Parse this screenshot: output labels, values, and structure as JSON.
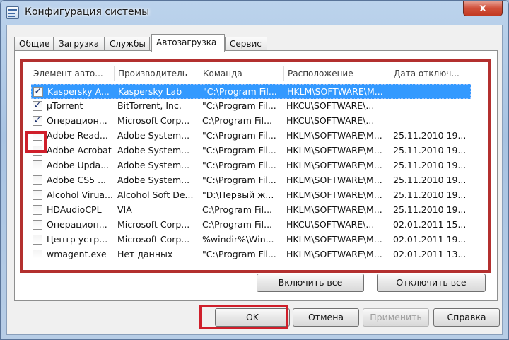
{
  "window": {
    "title": "Конфигурация системы",
    "close_glyph": "x"
  },
  "tabs": [
    {
      "label": "Общие",
      "active": false
    },
    {
      "label": "Загрузка",
      "active": false
    },
    {
      "label": "Службы",
      "active": false
    },
    {
      "label": "Автозагрузка",
      "active": true
    },
    {
      "label": "Сервис",
      "active": false
    }
  ],
  "table": {
    "columns": [
      "Элемент авто...",
      "Производитель",
      "Команда",
      "Расположение",
      "Дата отключ..."
    ],
    "rows": [
      {
        "checked": true,
        "selected": true,
        "name": "Kaspersky A...",
        "vendor": "Kaspersky Lab",
        "command": "\"C:\\Program Fil...",
        "location": "HKLM\\SOFTWARE\\M...",
        "date": ""
      },
      {
        "checked": true,
        "selected": false,
        "name": "µTorrent",
        "vendor": "BitTorrent, Inc.",
        "command": "\"C:\\Program Fil...",
        "location": "HKCU\\SOFTWARE\\...",
        "date": ""
      },
      {
        "checked": true,
        "selected": false,
        "name": "Операцион...",
        "vendor": "Microsoft Corp...",
        "command": "C:\\Program Fil...",
        "location": "HKCU\\SOFTWARE\\...",
        "date": ""
      },
      {
        "checked": false,
        "selected": false,
        "name": "Adobe Read...",
        "vendor": "Adobe System...",
        "command": "\"C:\\Program Fil...",
        "location": "HKLM\\SOFTWARE\\M...",
        "date": "25.11.2010 19..."
      },
      {
        "checked": false,
        "selected": false,
        "name": "Adobe Acrobat",
        "vendor": "Adobe System...",
        "command": "\"C:\\Program Fil...",
        "location": "HKLM\\SOFTWARE\\M...",
        "date": "25.11.2010 19..."
      },
      {
        "checked": false,
        "selected": false,
        "name": "Adobe Upda...",
        "vendor": "Adobe System...",
        "command": "\"C:\\Program Fil...",
        "location": "HKLM\\SOFTWARE\\M...",
        "date": "25.11.2010 19..."
      },
      {
        "checked": false,
        "selected": false,
        "name": "Adobe CS5 ...",
        "vendor": "Adobe System...",
        "command": "\"C:\\Program Fil...",
        "location": "HKLM\\SOFTWARE\\M...",
        "date": "25.11.2010 19..."
      },
      {
        "checked": false,
        "selected": false,
        "name": "Alcohol Virua...",
        "vendor": "Alcohol Soft De...",
        "command": "\"D:\\Первый ж...",
        "location": "HKLM\\SOFTWARE\\M...",
        "date": "25.11.2010 19..."
      },
      {
        "checked": false,
        "selected": false,
        "name": "HDAudioCPL",
        "vendor": "VIA",
        "command": "C:\\Program Fil...",
        "location": "HKLM\\SOFTWARE\\M...",
        "date": "25.11.2010 19..."
      },
      {
        "checked": false,
        "selected": false,
        "name": "Операцион...",
        "vendor": "Microsoft Corp...",
        "command": "C:\\Program Fil...",
        "location": "HKCU\\SOFTWARE\\...",
        "date": "02.01.2011 15..."
      },
      {
        "checked": false,
        "selected": false,
        "name": "Центр устр...",
        "vendor": "Microsoft Corp...",
        "command": "%windir%\\Win...",
        "location": "HKLM\\SOFTWARE\\M...",
        "date": "02.01.2011 19..."
      },
      {
        "checked": false,
        "selected": false,
        "name": "wmagent.exe",
        "vendor": "Нет данных",
        "command": "\"C:\\Program Fil...",
        "location": "HKLM\\SOFTWARE\\M...",
        "date": "02.01.2011 13..."
      }
    ]
  },
  "panel_buttons": {
    "enable_all": "Включить все",
    "disable_all": "Отключить все"
  },
  "dialog_buttons": {
    "ok": "OK",
    "cancel": "Отмена",
    "apply": "Применить",
    "help": "Справка"
  },
  "colors": {
    "annotation_red": "#cf1f2b",
    "selection_blue": "#3399ff"
  }
}
